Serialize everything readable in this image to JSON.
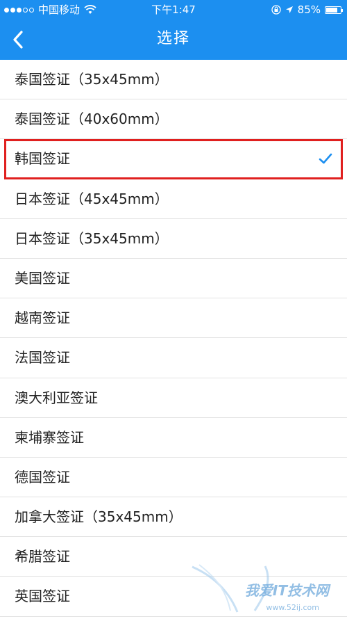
{
  "status_bar": {
    "carrier": "中国移动",
    "time": "下午1:47",
    "battery_percent": "85%",
    "battery_level": 0.85
  },
  "nav": {
    "title": "选择",
    "back_icon": "chevron-left-icon"
  },
  "colors": {
    "header_bg": "#1c8ff0",
    "checkmark": "#1c8ff0",
    "highlight_border": "#e0201f"
  },
  "list": {
    "selected_index": 2,
    "items": [
      {
        "label": "泰国签证（35x45mm）",
        "selected": false
      },
      {
        "label": "泰国签证（40x60mm）",
        "selected": false
      },
      {
        "label": "韩国签证",
        "selected": true
      },
      {
        "label": "日本签证（45x45mm）",
        "selected": false
      },
      {
        "label": "日本签证（35x45mm）",
        "selected": false
      },
      {
        "label": "美国签证",
        "selected": false
      },
      {
        "label": "越南签证",
        "selected": false
      },
      {
        "label": "法国签证",
        "selected": false
      },
      {
        "label": "澳大利亚签证",
        "selected": false
      },
      {
        "label": "柬埔寨签证",
        "selected": false
      },
      {
        "label": "德国签证",
        "selected": false
      },
      {
        "label": "加拿大签证（35x45mm）",
        "selected": false
      },
      {
        "label": "希腊签证",
        "selected": false
      },
      {
        "label": "英国签证",
        "selected": false
      }
    ]
  },
  "watermark": {
    "text": "我爱IT技术网",
    "url": "www.52ij.com"
  }
}
